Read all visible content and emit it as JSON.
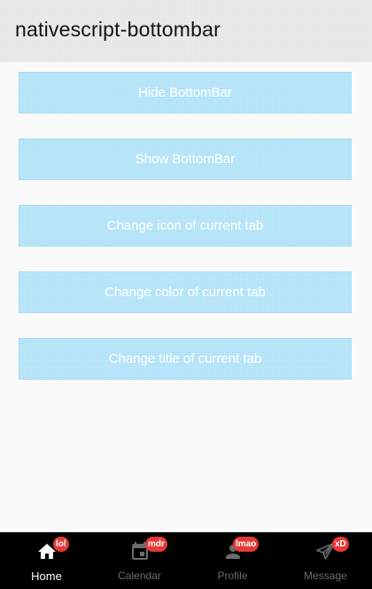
{
  "app": {
    "title": "nativescript-bottombar"
  },
  "buttons": [
    {
      "label": "Hide BottomBar"
    },
    {
      "label": "Show BottomBar"
    },
    {
      "label": "Change icon of current tab"
    },
    {
      "label": "Change color of current tab"
    },
    {
      "label": "Change title of current tab"
    }
  ],
  "bottombar": {
    "active_index": 0,
    "tabs": [
      {
        "label": "Home",
        "icon": "home-icon",
        "badge": "lol"
      },
      {
        "label": "Calendar",
        "icon": "calendar-icon",
        "badge": "mdr"
      },
      {
        "label": "Profile",
        "icon": "person-icon",
        "badge": "lmao"
      },
      {
        "label": "Message",
        "icon": "send-icon",
        "badge": "xD"
      }
    ]
  },
  "colors": {
    "button_bg": "#b3e5fc",
    "bar_bg": "#000000",
    "badge_bg": "#e53935",
    "active_label": "#ffffff",
    "inactive_label": "#6b6b6b"
  }
}
